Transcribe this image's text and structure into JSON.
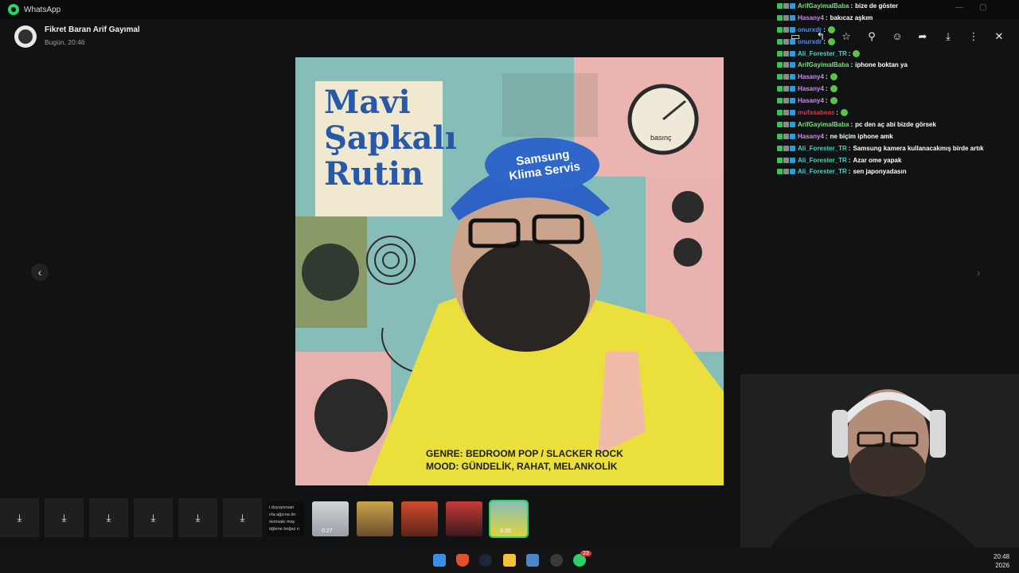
{
  "app": {
    "title": "WhatsApp"
  },
  "viewer": {
    "sender": "Fikret Baran Arif Gayımal",
    "time": "Bugün, 20:46",
    "icons": [
      "reply-icon",
      "star-icon",
      "pin-icon",
      "emoji-icon",
      "forward-icon",
      "download-icon",
      "more-icon",
      "close-icon"
    ]
  },
  "cover": {
    "title_line1": "Mavi",
    "title_line2": "Şapkalı",
    "title_line3": "Rutin",
    "cap_line1": "Samsung",
    "cap_line2": "Klima Servis",
    "gauge_label": "basınç",
    "genre": "GENRE: BEDROOM POP / SLACKER ROCK",
    "mood": "MOOD: GÜNDELİK, RAHAT, MELANKOLİK"
  },
  "chat": {
    "messages": [
      {
        "user": "ArifGayimalBaba",
        "color": "#7be07b",
        "text": "bize de göster"
      },
      {
        "user": "Hasany4",
        "color": "#c98cf0",
        "text": "bakıcaz aşkım"
      },
      {
        "user": "onurxdr",
        "color": "#4a8cff",
        "text": ""
      },
      {
        "user": "onurxdr",
        "color": "#4a8cff",
        "text": ""
      },
      {
        "user": "Ali_Forester_TR",
        "color": "#3fd6c8",
        "text": ""
      },
      {
        "user": "ArifGayimalBaba",
        "color": "#7be07b",
        "text": "iphone boktan ya"
      },
      {
        "user": "Hasany4",
        "color": "#c98cf0",
        "text": ""
      },
      {
        "user": "Hasany4",
        "color": "#c98cf0",
        "text": ""
      },
      {
        "user": "Hasany4",
        "color": "#c98cf0",
        "text": ""
      },
      {
        "user": "mufasabeas",
        "color": "#e0343e",
        "text": ""
      },
      {
        "user": "ArifGayimalBaba",
        "color": "#7be07b",
        "text": "pc den aç abi bizde görsek"
      },
      {
        "user": "Hasany4",
        "color": "#c98cf0",
        "text": "ne biçim iphone amk"
      },
      {
        "user": "Ali_Forester_TR",
        "color": "#3fd6c8",
        "text": "Samsung kamera kullanacakmış birde artık"
      },
      {
        "user": "Ali_Forester_TR",
        "color": "#3fd6c8",
        "text": "Azar ome yapak"
      },
      {
        "user": "Ali_Forester_TR",
        "color": "#3fd6c8",
        "text": "sen japonyadasın"
      }
    ]
  },
  "strip": {
    "text_snippet": [
      "i duyuyorsan",
      "ırla ağzına ön",
      "ıkımsakı may",
      "öğtene boğaz n"
    ],
    "video1_duration": "0:27",
    "video2_duration": "0:30"
  },
  "taskbar": {
    "whatsapp_badge": "23",
    "clock_time": "20:48",
    "clock_date": "2026"
  }
}
